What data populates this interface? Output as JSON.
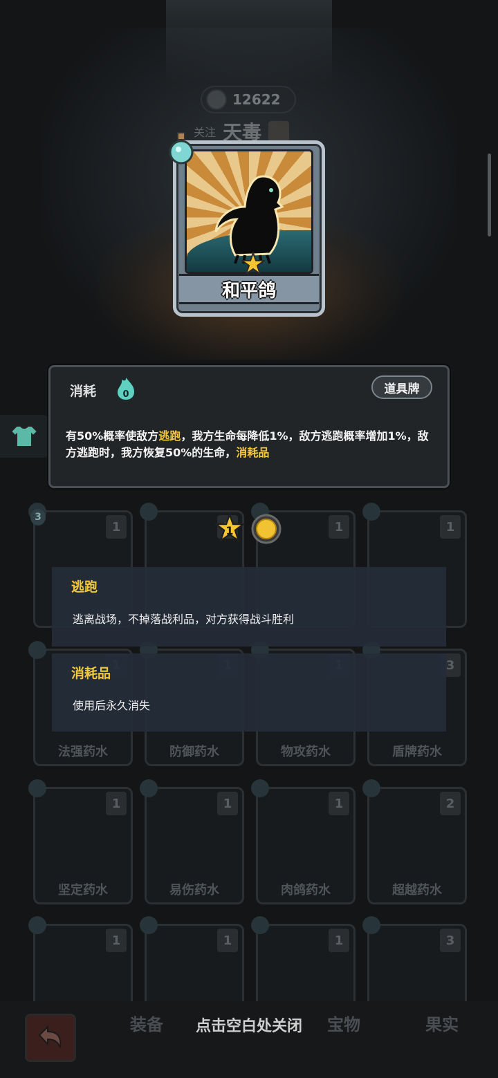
{
  "header": {
    "coins": "12622",
    "nickname_prefix": "关注",
    "nickname": "天毒"
  },
  "card": {
    "name": "和平鸽",
    "icon": "dove-icon",
    "rarity_stars": 1
  },
  "info": {
    "cost_label": "消耗",
    "cost_value": "0",
    "type_badge": "道具牌",
    "desc_parts": {
      "p1": "有50%概率使敌方",
      "k1": "逃跑",
      "p2": "，我方生命每降低1%，敌方逃跑概率增加1%，敌方逃跑时，我方恢复50%的生命，",
      "k2": "消耗品"
    }
  },
  "badges": {
    "star_level": "1"
  },
  "keywords": [
    {
      "title": "逃跑",
      "text": "逃离战场，不掉落战利品，对方获得战斗胜利"
    },
    {
      "title": "消耗品",
      "text": "使用后永久消失"
    }
  ],
  "grid": {
    "row2": [
      "法强药水",
      "防御药水",
      "物攻药水",
      "盾牌药水"
    ],
    "row3": [
      "坚定药水",
      "易伤药水",
      "肉鸽药水",
      "超越药水"
    ],
    "levels_row1": [
      "1",
      "1",
      "1",
      "1"
    ],
    "levels_row2": [
      "1",
      "1",
      "1",
      "3"
    ],
    "levels_row3": [
      "1",
      "1",
      "1",
      "2"
    ],
    "levels_row4": [
      "1",
      "1",
      "1",
      "3"
    ],
    "badge_count": "3"
  },
  "bottom": {
    "close_hint": "点击空白处关闭",
    "tabs": [
      "装备",
      "宝物",
      "果实"
    ]
  },
  "colors": {
    "keyword": "#f3c838",
    "panel": "#222528",
    "keyword_panel": "#252c3a"
  }
}
